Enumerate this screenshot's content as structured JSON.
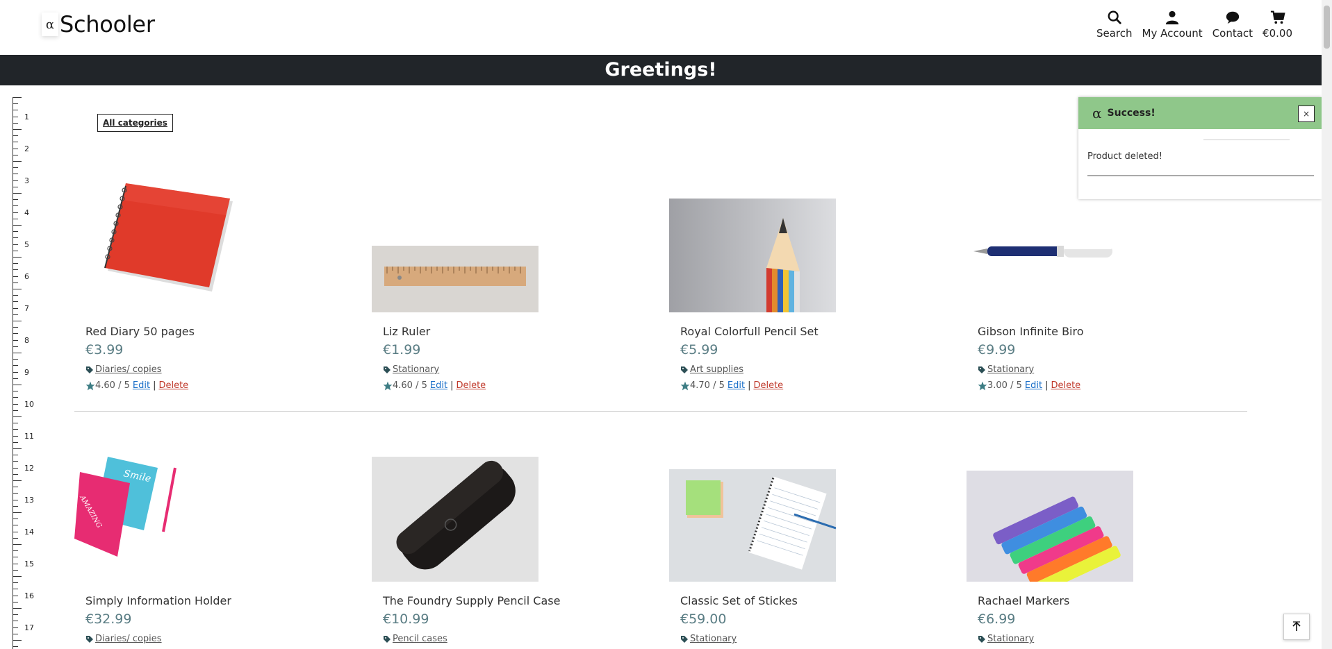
{
  "header": {
    "logo_mark": "α",
    "logo_text": "Schooler",
    "nav": [
      {
        "label": "Search",
        "icon": "search-icon"
      },
      {
        "label": "My Account",
        "icon": "user-icon"
      },
      {
        "label": "Contact",
        "icon": "chat-icon"
      },
      {
        "label": "€0.00",
        "icon": "cart-icon"
      }
    ]
  },
  "banner": {
    "text": "Greetings!"
  },
  "ruler": {
    "labels": [
      "1",
      "2",
      "3",
      "4",
      "5",
      "6",
      "7",
      "8",
      "9",
      "10",
      "11",
      "12",
      "13",
      "14",
      "15",
      "16",
      "17"
    ]
  },
  "filter": {
    "label": "All categories"
  },
  "products": [
    {
      "name": "Red Diary 50 pages",
      "price": "€3.99",
      "category": "Diaries/ copies",
      "rating": "4.60 / 5",
      "edit": "Edit",
      "delete": "Delete"
    },
    {
      "name": "Liz Ruler",
      "price": "€1.99",
      "category": "Stationary",
      "rating": "4.60 / 5",
      "edit": "Edit",
      "delete": "Delete"
    },
    {
      "name": "Royal Colorfull Pencil Set",
      "price": "€5.99",
      "category": "Art supplies",
      "rating": "4.70 / 5",
      "edit": "Edit",
      "delete": "Delete"
    },
    {
      "name": "Gibson Infinite Biro",
      "price": "€9.99",
      "category": "Stationary",
      "rating": "3.00 / 5",
      "edit": "Edit",
      "delete": "Delete"
    },
    {
      "name": "Simply Information Holder",
      "price": "€32.99",
      "category": "Diaries/ copies"
    },
    {
      "name": "The Foundry Supply Pencil Case",
      "price": "€10.99",
      "category": "Pencil cases"
    },
    {
      "name": "Classic Set of Stickes",
      "price": "€59.00",
      "category": "Stationary"
    },
    {
      "name": "Rachael Markers",
      "price": "€6.99",
      "category": "Stationary"
    }
  ],
  "toast": {
    "alpha": "α",
    "title": "Success!",
    "close": "×",
    "message": "Product deleted!"
  },
  "colors": {
    "banner": "#212529",
    "toast_header": "#8fc78a",
    "price": "#5a7d84",
    "edit_link": "#1a6fc9",
    "delete_link": "#c0392b"
  }
}
